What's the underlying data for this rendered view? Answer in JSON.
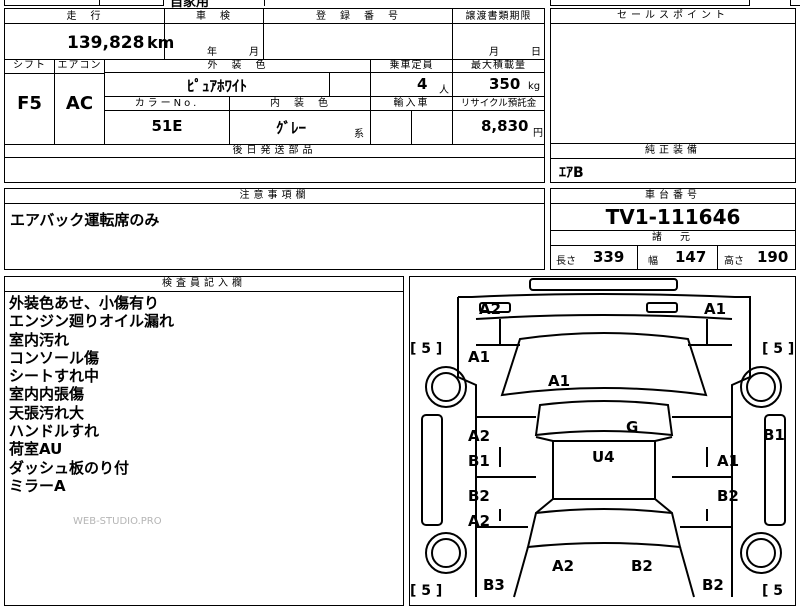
{
  "top_fragment": "自家用",
  "mileage": {
    "header": "走　行",
    "value": "139,828",
    "unit": "km"
  },
  "inspection": {
    "header": "車　検",
    "year_label": "年",
    "month_label": "月"
  },
  "registration": {
    "header": "登　録　番　号"
  },
  "transfer_deadline": {
    "header": "譲渡書類期限",
    "month_label": "月",
    "day_label": "日"
  },
  "selling_points": {
    "header": "セールスポイント"
  },
  "shift": {
    "header": "シフト",
    "value": "F5"
  },
  "aircon": {
    "header": "エアコン",
    "value": "AC"
  },
  "exterior_color": {
    "header": "外　装　色",
    "value": "ﾋﾟｭｱﾎﾜｲﾄ"
  },
  "capacity": {
    "header": "乗車定員",
    "value": "4",
    "unit": "人"
  },
  "max_load": {
    "header": "最大積載量",
    "value": "350",
    "unit": "kg"
  },
  "color_no": {
    "header": "カラーNo.",
    "value": "51E"
  },
  "interior_color": {
    "header": "内　装　色",
    "value": "ｸﾞﾚｰ",
    "suffix": "系"
  },
  "import_car": {
    "header": "輸入車"
  },
  "recycle_fee": {
    "header": "リサイクル預託金",
    "value": "8,830",
    "unit": "円"
  },
  "later_parts": {
    "header": "後日発送部品"
  },
  "genuine_equipment": {
    "header": "純正装備",
    "value": "ｴｱB"
  },
  "notes": {
    "header": "注意事項欄",
    "value": "エアバック運転席のみ"
  },
  "chassis": {
    "header": "車台番号",
    "value": "TV1-111646"
  },
  "specs": {
    "header": "諸　元",
    "length_label": "長さ",
    "length": "339",
    "width_label": "幅",
    "width": "147",
    "height_label": "高さ",
    "height": "190"
  },
  "inspector": {
    "header": "検査員記入欄",
    "lines": [
      "外装色あせ、小傷有り",
      "エンジン廻りオイル漏れ",
      "室内汚れ",
      "コンソール傷",
      "シートすれ中",
      "室内内張傷",
      "天張汚れ大",
      "ハンドルすれ",
      "荷室AU",
      "ダッシュ板のり付",
      "ミラーA"
    ]
  },
  "watermark": "WEB-STUDIO.PRO",
  "diagram": {
    "tires": [
      "[ 5 ]",
      "[ 5 ]",
      "[ 5 ]",
      "[ 5"
    ],
    "damage": [
      "A2",
      "A1",
      "A1",
      "A1",
      "G",
      "B1",
      "A2",
      "B1",
      "U4",
      "A1",
      "B2",
      "B2",
      "A2",
      "A2",
      "B2",
      "B3",
      "B2"
    ]
  }
}
